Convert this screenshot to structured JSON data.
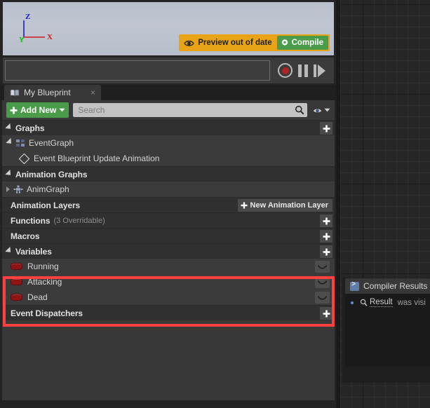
{
  "viewport": {
    "gizmo": {
      "z_label": "Z",
      "x_label": "X",
      "y_label": "Y",
      "z_color": "#1b1bd8",
      "x_color": "#d01a1a",
      "y_color": "#1ac01a"
    },
    "preview_badge": {
      "label": "Preview out of date",
      "icon": "eye-icon",
      "color": "#e8a317"
    },
    "compile_button": {
      "label": "Compile",
      "icon": "gear-icon",
      "color": "#4a9c4a"
    }
  },
  "transport": {
    "record_icon": "record-icon",
    "pause_icon": "pause-icon",
    "step_icon": "step-forward-icon"
  },
  "tab": {
    "title": "My Blueprint",
    "icon": "book-icon",
    "close": "×"
  },
  "toolbar": {
    "add_new_label": "Add New",
    "add_new_icon": "plus-icon",
    "search_placeholder": "Search",
    "search_icon": "magnifier-icon",
    "eye_icon": "eye-icon",
    "chevron_icon": "chevron-down-icon"
  },
  "sections": {
    "graphs": {
      "title": "Graphs",
      "plus": "+"
    },
    "event_graph": {
      "label": "EventGraph",
      "icon": "event-graph-icon"
    },
    "event_node": {
      "label": "Event Blueprint Update Animation",
      "icon": "event-node-diamond-icon"
    },
    "animation_graphs": {
      "title": "Animation Graphs"
    },
    "anim_graph": {
      "label": "AnimGraph",
      "icon": "anim-graph-icon"
    },
    "animation_layers": {
      "title": "Animation Layers",
      "button_label": "New Animation Layer"
    },
    "functions": {
      "title": "Functions",
      "subtitle": "(3 Overridable)",
      "plus": "+"
    },
    "macros": {
      "title": "Macros",
      "plus": "+"
    },
    "variables": {
      "title": "Variables",
      "plus": "+"
    },
    "event_dispatchers": {
      "title": "Event Dispatchers",
      "plus": "+"
    }
  },
  "variables": [
    {
      "name": "Running",
      "type": "boolean",
      "pin_color": "#8e1313",
      "visibility_icon": "eye-closed-icon"
    },
    {
      "name": "Attacking",
      "type": "boolean",
      "pin_color": "#8e1313",
      "visibility_icon": "eye-closed-icon"
    },
    {
      "name": "Dead",
      "type": "boolean",
      "pin_color": "#8e1313",
      "visibility_icon": "eye-closed-icon"
    }
  ],
  "highlight": {
    "color": "#ff4040"
  },
  "compiler_results": {
    "tab_title": "Compiler Results",
    "tab_icon": "console-icon",
    "message_link": "Result",
    "message_rest": "was visi",
    "link_icon": "magnifier-icon"
  }
}
